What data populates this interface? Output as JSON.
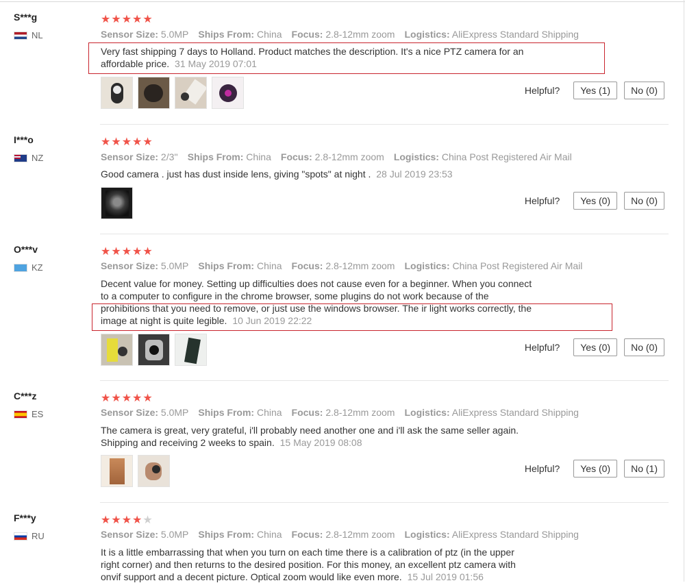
{
  "reviews": [
    {
      "user": "S***g",
      "country": "NL",
      "stars": 5,
      "meta": {
        "sensor_label": "Sensor Size:",
        "sensor": "5.0MP",
        "ships_label": "Ships From:",
        "ships": "China",
        "focus_label": "Focus:",
        "focus": "2.8-12mm zoom",
        "logistics_label": "Logistics:",
        "logistics": "AliExpress Standard Shipping"
      },
      "text_lines": [
        "Very fast shipping 7 days to Holland. Product matches the description. It's a nice PTZ camera for an",
        "affordable price."
      ],
      "date": "31 May 2019 07:01",
      "thumbs": 4,
      "helpful_label": "Helpful?",
      "yes": "Yes (1)",
      "no": "No (0)"
    },
    {
      "user": "I***o",
      "country": "NZ",
      "stars": 5,
      "meta": {
        "sensor_label": "Sensor Size:",
        "sensor": "2/3''",
        "ships_label": "Ships From:",
        "ships": "China",
        "focus_label": "Focus:",
        "focus": "2.8-12mm zoom",
        "logistics_label": "Logistics:",
        "logistics": "China Post Registered Air Mail"
      },
      "text_lines": [
        "Good camera . just has dust inside lens, giving \"spots\" at night ."
      ],
      "date": "28 Jul 2019 23:53",
      "thumbs": 1,
      "helpful_label": "Helpful?",
      "yes": "Yes (0)",
      "no": "No (0)"
    },
    {
      "user": "O***v",
      "country": "KZ",
      "stars": 5,
      "meta": {
        "sensor_label": "Sensor Size:",
        "sensor": "5.0MP",
        "ships_label": "Ships From:",
        "ships": "China",
        "focus_label": "Focus:",
        "focus": "2.8-12mm zoom",
        "logistics_label": "Logistics:",
        "logistics": "China Post Registered Air Mail"
      },
      "text_lines": [
        "Decent value for money. Setting up difficulties does not cause even for a beginner. When you connect",
        "to a computer to configure in the chrome browser, some plugins do not work because of the",
        "prohibitions that you need to remove, or just use the windows browser. The ir light works correctly, the",
        "image at night is quite legible."
      ],
      "date": "10 Jun 2019 22:22",
      "thumbs": 3,
      "helpful_label": "Helpful?",
      "yes": "Yes (0)",
      "no": "No (0)"
    },
    {
      "user": "C***z",
      "country": "ES",
      "stars": 5,
      "meta": {
        "sensor_label": "Sensor Size:",
        "sensor": "5.0MP",
        "ships_label": "Ships From:",
        "ships": "China",
        "focus_label": "Focus:",
        "focus": "2.8-12mm zoom",
        "logistics_label": "Logistics:",
        "logistics": "AliExpress Standard Shipping"
      },
      "text_lines": [
        "The camera is great, very grateful, i'll probably need another one and i'll ask the same seller again.",
        "Shipping and receiving 2 weeks to spain."
      ],
      "date": "15 May 2019 08:08",
      "thumbs": 2,
      "helpful_label": "Helpful?",
      "yes": "Yes (0)",
      "no": "No (1)"
    },
    {
      "user": "F***y",
      "country": "RU",
      "stars": 4,
      "meta": {
        "sensor_label": "Sensor Size:",
        "sensor": "5.0MP",
        "ships_label": "Ships From:",
        "ships": "China",
        "focus_label": "Focus:",
        "focus": "2.8-12mm zoom",
        "logistics_label": "Logistics:",
        "logistics": "AliExpress Standard Shipping"
      },
      "text_lines": [
        "It is a little embarrassing that when you turn on each time there is a calibration of ptz (in the upper",
        "right corner) and then returns to the desired position. For this money, an excellent ptz camera with",
        "onvif support and a decent picture. Optical zoom would like even more."
      ],
      "date": "15 Jul 2019 01:56",
      "thumbs": 0
    }
  ]
}
